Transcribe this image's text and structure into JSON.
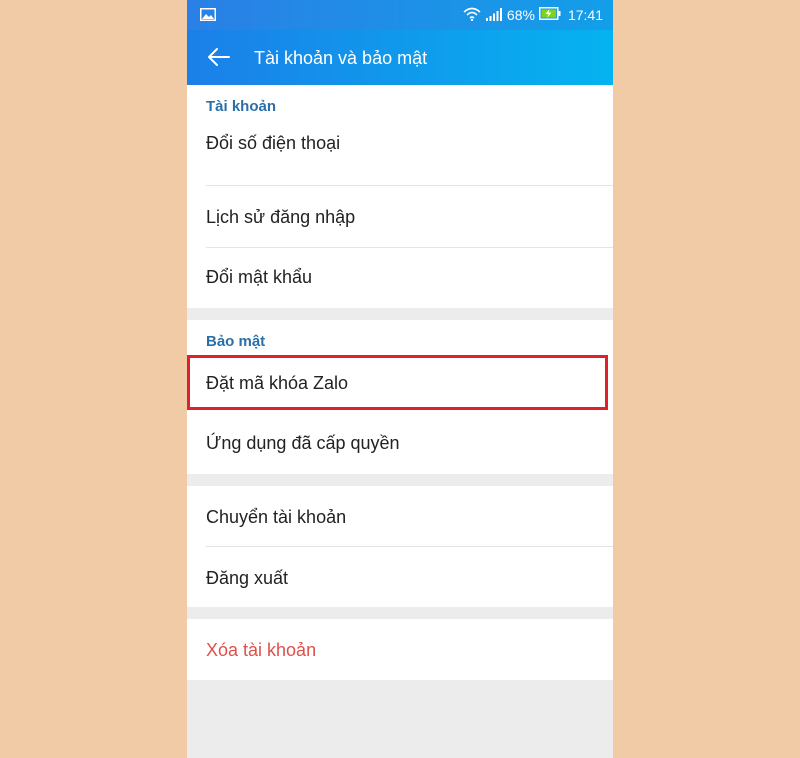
{
  "status_bar": {
    "battery_percent": "68%",
    "time": "17:41",
    "icons": [
      "image-icon",
      "wifi-icon",
      "signal-icon",
      "battery-charging-icon"
    ]
  },
  "app_bar": {
    "title": "Tài khoản và bảo mật",
    "back_icon": "arrow-left-icon"
  },
  "sections": {
    "account": {
      "header": "Tài khoản",
      "items": [
        "Đổi số điện thoại",
        "Lịch sử đăng nhập",
        "Đổi mật khẩu"
      ]
    },
    "security": {
      "header": "Bảo mật",
      "items": [
        "Đặt mã khóa Zalo",
        "Ứng dụng đã cấp quyền"
      ]
    },
    "session": {
      "items": [
        "Chuyển tài khoản",
        "Đăng xuất"
      ]
    },
    "danger": {
      "items": [
        "Xóa tài khoản"
      ]
    }
  },
  "colors": {
    "appbar_start": "#1b7fe8",
    "appbar_end": "#05b3f0",
    "section_header": "#2a6fa8",
    "danger_text": "#e0504a",
    "highlight_border": "#e0202c",
    "page_background": "#f0cba6"
  }
}
